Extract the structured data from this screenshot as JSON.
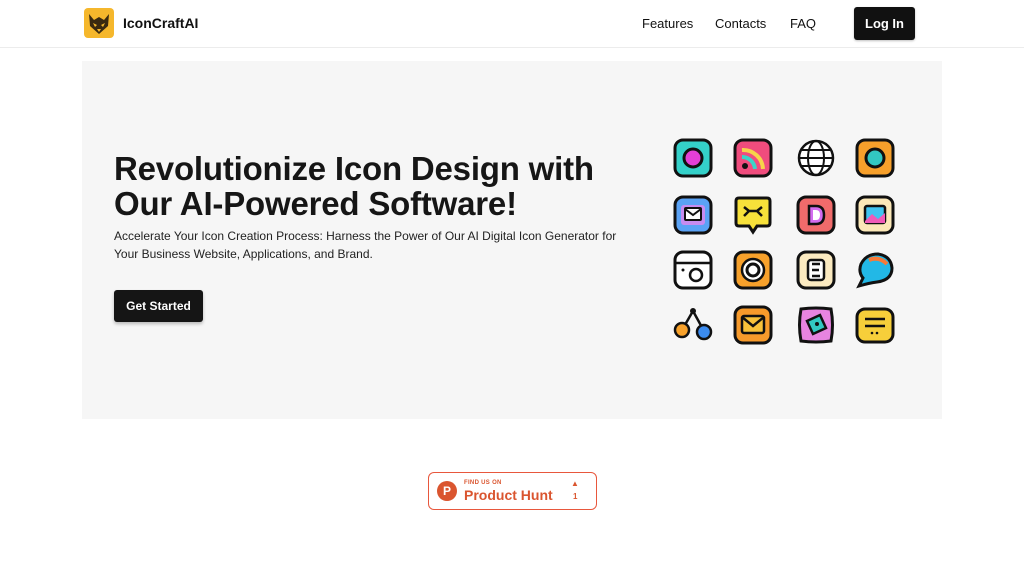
{
  "header": {
    "brand": "IconCraftAI",
    "nav": [
      "Features",
      "Contacts",
      "FAQ"
    ],
    "login_label": "Log In"
  },
  "hero": {
    "title": "Revolutionize Icon Design with Our AI-Powered Software!",
    "subtitle": "Accelerate Your Icon Creation Process: Harness the Power of Our AI Digital Icon Generator for Your Business Website, Applications, and Brand.",
    "cta_label": "Get Started"
  },
  "icon_grid": [
    "camera-lens-icon",
    "rss-feed-icon",
    "globe-icon",
    "circle-frame-icon",
    "mail-icon",
    "chat-bubble-icon",
    "letter-d-icon",
    "image-icon",
    "camera-icon",
    "target-icon",
    "letter-e-icon",
    "speech-bubble-icon",
    "network-nodes-icon",
    "envelope-icon",
    "photo-icon",
    "message-box-icon"
  ],
  "product_hunt": {
    "tagline": "FIND US ON",
    "name": "Product Hunt",
    "logo_letter": "P",
    "upvote_arrow": "▲",
    "upvotes": "1"
  },
  "colors": {
    "primary": "#111111",
    "hero_bg": "#f6f6f6",
    "product_hunt": "#da552f"
  }
}
